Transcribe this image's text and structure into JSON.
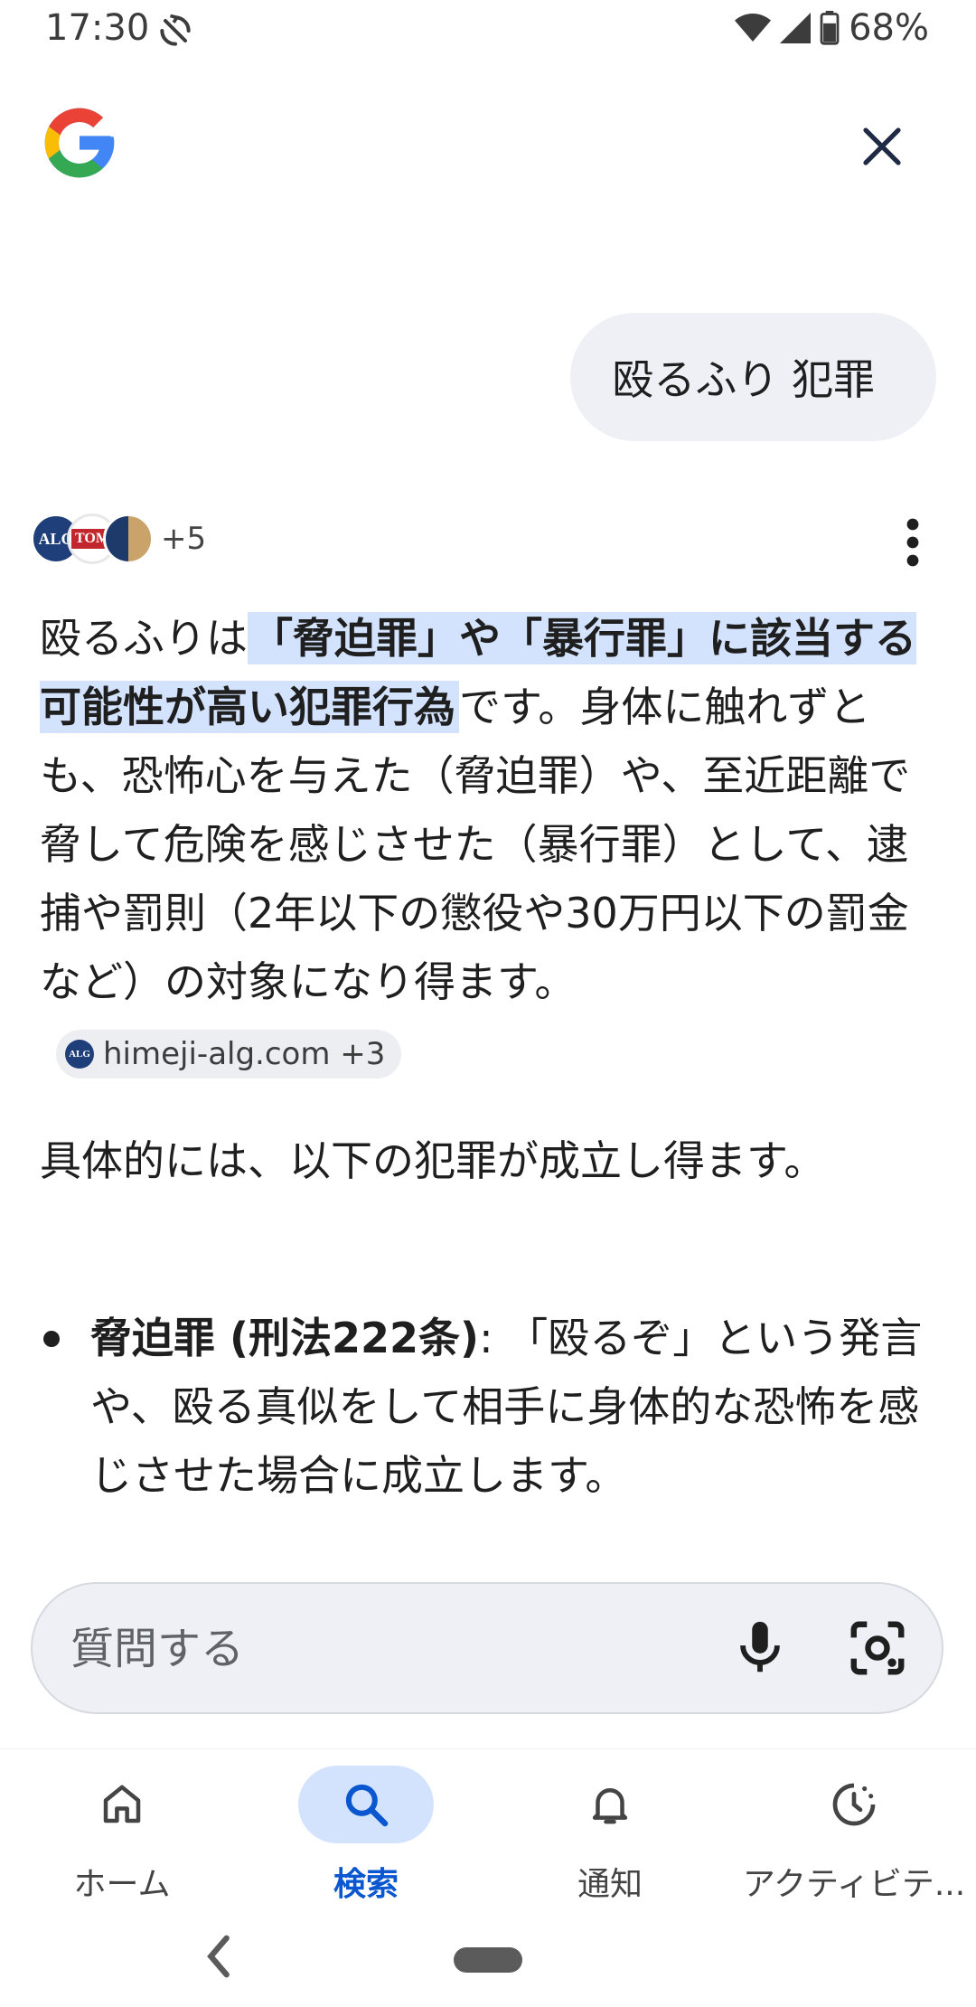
{
  "status_bar": {
    "time": "17:30",
    "battery": "68%"
  },
  "query": {
    "text": "殴るふり 犯罪"
  },
  "sources": {
    "logo1": "ALG",
    "logo2": "TOM",
    "more": "+5"
  },
  "answer": {
    "p1_before": "殴るふりは",
    "p1_highlight": "「脅迫罪」や「暴行罪」に該当する可能性が高い犯罪行為",
    "p1_after": "です。身体に触れずとも、恐怖心を与えた（脅迫罪）や、至近距離で脅して危険を感じさせた（暴行罪）として、逮捕や罰則（2年以下の懲役や30万円以下の罰金など）の対象になり得ます。",
    "citation": {
      "icon": "ALG",
      "label": "himeji-alg.com +3"
    },
    "p2": "具体的には、以下の犯罪が成立し得ます。",
    "bullets": [
      {
        "term": "脅迫罪 (刑法222条)",
        "sep": ": ",
        "text": "「殴るぞ」という発言や、殴る真似をして相手に身体的な恐怖を感じさせた場合に成立します。"
      }
    ]
  },
  "ask_bar": {
    "placeholder": "質問する"
  },
  "bottom_nav": [
    {
      "label": "ホーム",
      "icon": "home-icon"
    },
    {
      "label": "検索",
      "icon": "search-icon",
      "active": true
    },
    {
      "label": "通知",
      "icon": "bell-icon"
    },
    {
      "label": "アクティビテ...",
      "icon": "activity-icon"
    }
  ],
  "colors": {
    "accent": "#0b57d0",
    "highlight": "#d3e3fd",
    "bubble": "#eef0f6"
  }
}
